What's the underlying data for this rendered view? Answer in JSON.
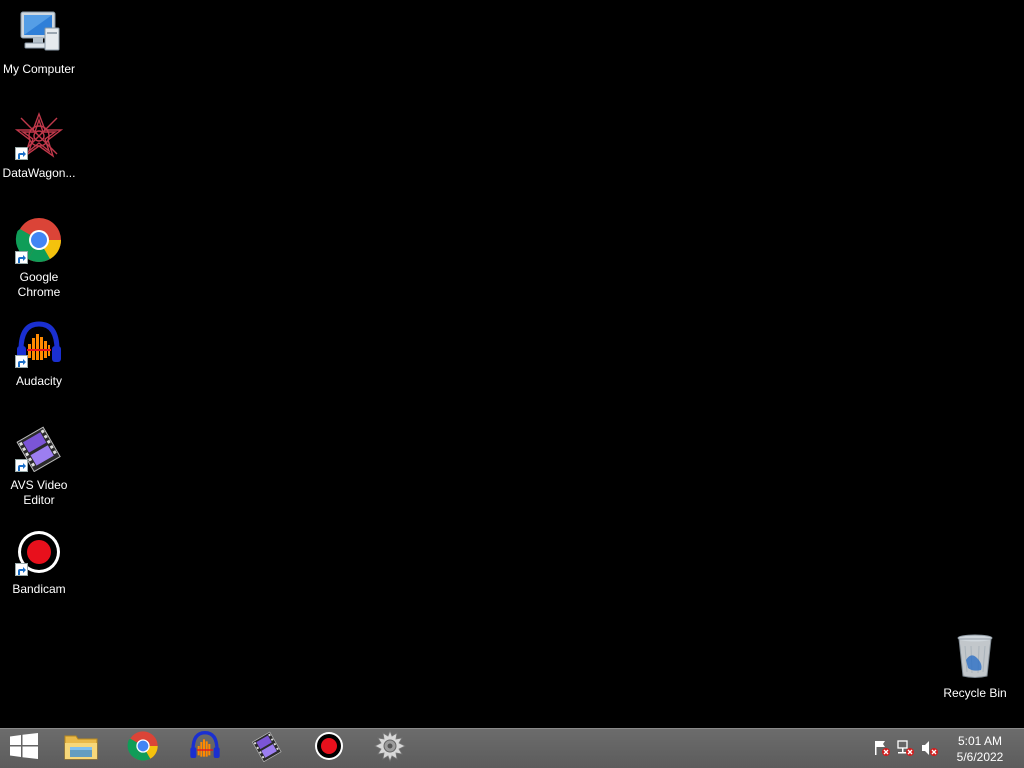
{
  "desktop": {
    "icons": [
      {
        "label": "My Computer",
        "icon": "computer-icon"
      },
      {
        "label": "DataWagon...",
        "icon": "datawagon-icon"
      },
      {
        "label": "Google Chrome",
        "icon": "chrome-icon"
      },
      {
        "label": "Audacity",
        "icon": "audacity-icon"
      },
      {
        "label": "AVS Video Editor",
        "icon": "avs-video-editor-icon"
      },
      {
        "label": "Bandicam",
        "icon": "bandicam-icon"
      }
    ],
    "recycle_bin": {
      "label": "Recycle Bin",
      "icon": "recycle-bin-icon"
    }
  },
  "taskbar": {
    "start": {
      "icon": "windows-logo-icon"
    },
    "pinned": [
      {
        "icon": "file-explorer-icon"
      },
      {
        "icon": "chrome-icon"
      },
      {
        "icon": "audacity-icon"
      },
      {
        "icon": "avs-video-editor-icon"
      },
      {
        "icon": "bandicam-icon"
      },
      {
        "icon": "settings-gear-icon"
      }
    ],
    "tray": [
      {
        "icon": "action-center-flag-icon"
      },
      {
        "icon": "network-disconnected-icon"
      },
      {
        "icon": "volume-muted-icon"
      }
    ],
    "clock": {
      "time": "5:01 AM",
      "date": "5/6/2022"
    }
  },
  "colors": {
    "desktop_bg": "#000000",
    "taskbar_bg": "#646464",
    "bandicam_red": "#e8101c",
    "chrome_red": "#db4437",
    "chrome_yellow": "#f4c20d",
    "chrome_green": "#0f9d58",
    "chrome_blue": "#4285f4"
  }
}
